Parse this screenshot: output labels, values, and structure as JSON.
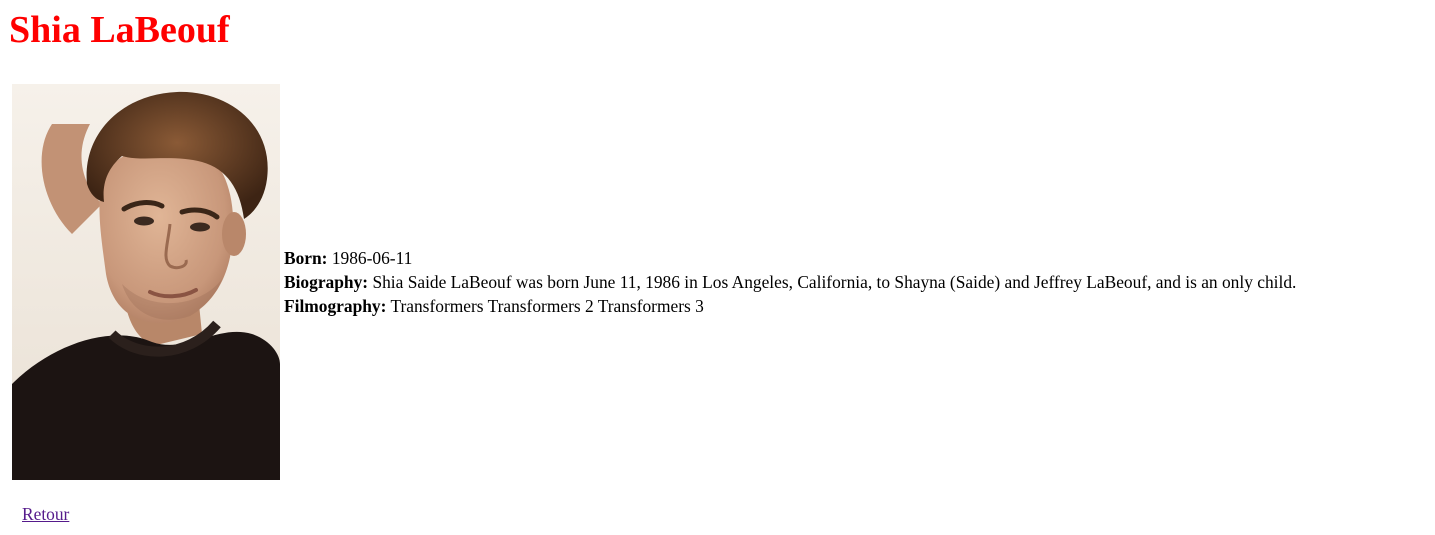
{
  "actor": {
    "name": "Shia LaBeouf",
    "born_label": "Born:",
    "born_value": "1986-06-11",
    "biography_label": "Biography:",
    "biography_value": "Shia Saide LaBeouf was born June 11, 1986 in Los Angeles, California, to Shayna (Saide) and Jeffrey LaBeouf, and is an only child.",
    "filmography_label": "Filmography:",
    "filmography_value": "Transformers Transformers 2 Transformers 3"
  },
  "navigation": {
    "back_label": "Retour"
  },
  "colors": {
    "title": "#ff0000",
    "link_visited": "#551a8b",
    "background": "#ffffff"
  }
}
